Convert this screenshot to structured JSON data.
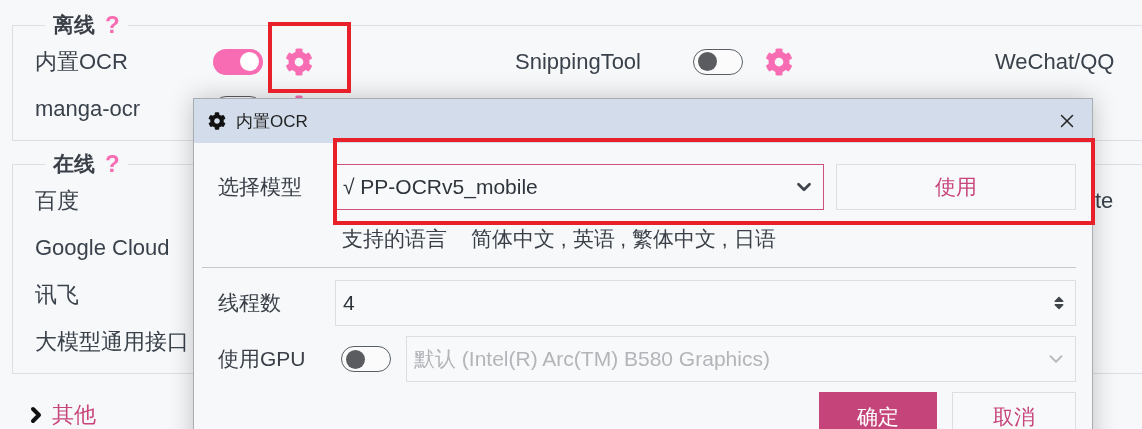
{
  "settings": {
    "groups": [
      {
        "title": "离线",
        "help": "?",
        "rows": [
          [
            {
              "kind": "engine",
              "label": "内置OCR",
              "on": true
            },
            {
              "kind": "engine",
              "label": "SnippingTool",
              "on": false
            },
            {
              "kind": "label",
              "label": "WeChat/QQ"
            }
          ],
          [
            {
              "kind": "engine",
              "label": "manga-ocr",
              "on": false
            }
          ]
        ]
      },
      {
        "title": "在线",
        "help": "?",
        "rows": [
          [
            {
              "kind": "label",
              "label": "百度"
            },
            {
              "kind": "empty"
            },
            {
              "kind": "tail",
              "label": "te"
            }
          ],
          [
            {
              "kind": "label",
              "label": "Google Cloud"
            }
          ],
          [
            {
              "kind": "label",
              "label": "讯飞"
            }
          ],
          [
            {
              "kind": "label",
              "label": "大模型通用接口"
            }
          ]
        ]
      }
    ],
    "more": {
      "label": "其他",
      "expanded": false
    }
  },
  "dialog": {
    "title": "内置OCR",
    "model": {
      "label": "选择模型",
      "value": "√ PP-OCRv5_mobile",
      "button": "使用"
    },
    "languages": {
      "label": "支持的语言",
      "value": "简体中文 , 英语 , 繁体中文 , 日语"
    },
    "threads": {
      "label": "线程数",
      "value": "4"
    },
    "gpu": {
      "label": "使用GPU",
      "on": false,
      "device": "默认 (Intel(R) Arc(TM) B580 Graphics)",
      "disabled": true
    },
    "buttons": [
      {
        "label": "确定",
        "kind": "primary"
      },
      {
        "label": "取消",
        "kind": "secondary"
      }
    ]
  }
}
